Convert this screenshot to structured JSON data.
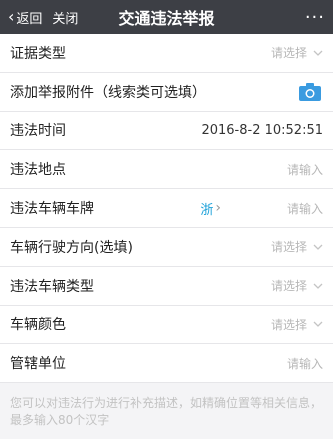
{
  "header": {
    "back_label": "返回",
    "close_label": "关闭",
    "title": "交通违法举报",
    "more_label": "···"
  },
  "form": {
    "rows": [
      {
        "label": "证据类型",
        "placeholder": "请选择"
      },
      {
        "label": "添加举报附件（线索类可选填）"
      },
      {
        "label": "违法时间",
        "value": "2016-8-2 10:52:51"
      },
      {
        "label": "违法地点",
        "placeholder": "请输入"
      },
      {
        "label": "违法车辆车牌",
        "province": "浙",
        "placeholder": "请输入"
      },
      {
        "label": "车辆行驶方向(选填)",
        "placeholder": "请选择"
      },
      {
        "label": "违法车辆类型",
        "placeholder": "请选择"
      },
      {
        "label": "车辆颜色",
        "placeholder": "请选择"
      },
      {
        "label": "管辖单位",
        "placeholder": "请输入"
      }
    ]
  },
  "description": {
    "placeholder": "您可以对违法行为进行补充描述，如精确位置等相关信息，最多输入80个汉字"
  },
  "colors": {
    "topbar": "#3d3f45",
    "accent": "#1aa0d8",
    "camera": "#3a9be0"
  }
}
